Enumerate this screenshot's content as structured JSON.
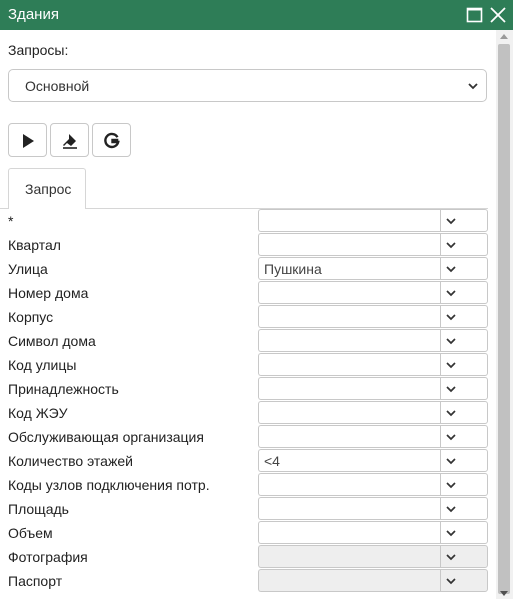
{
  "window": {
    "title": "Здания"
  },
  "queries": {
    "label": "Запросы:",
    "selected": "Основной"
  },
  "toolbar": {
    "run_icon": "play-icon",
    "clear_icon": "eraser-icon",
    "google_icon": "google-g-icon"
  },
  "tabs": [
    {
      "label": "Запрос"
    }
  ],
  "fields": [
    {
      "label": "*",
      "value": "",
      "disabled": false
    },
    {
      "label": "Квартал",
      "value": "",
      "disabled": false
    },
    {
      "label": "Улица",
      "value": "Пушкина",
      "disabled": false
    },
    {
      "label": "Номер дома",
      "value": "",
      "disabled": false
    },
    {
      "label": "Корпус",
      "value": "",
      "disabled": false
    },
    {
      "label": "Символ дома",
      "value": "",
      "disabled": false
    },
    {
      "label": "Код улицы",
      "value": "",
      "disabled": false
    },
    {
      "label": "Принадлежность",
      "value": "",
      "disabled": false
    },
    {
      "label": "Код ЖЭУ",
      "value": "",
      "disabled": false
    },
    {
      "label": "Обслуживающая организация",
      "value": "",
      "disabled": false
    },
    {
      "label": "Количество этажей",
      "value": "<4",
      "disabled": false
    },
    {
      "label": "Коды узлов подключения потр.",
      "value": "",
      "disabled": false
    },
    {
      "label": "Площадь",
      "value": "",
      "disabled": false
    },
    {
      "label": "Объем",
      "value": "",
      "disabled": false
    },
    {
      "label": "Фотография",
      "value": "",
      "disabled": true
    },
    {
      "label": "Паспорт",
      "value": "",
      "disabled": true
    }
  ],
  "colors": {
    "titlebar": "#2e7d57",
    "disabled_field": "#eeeeee"
  }
}
